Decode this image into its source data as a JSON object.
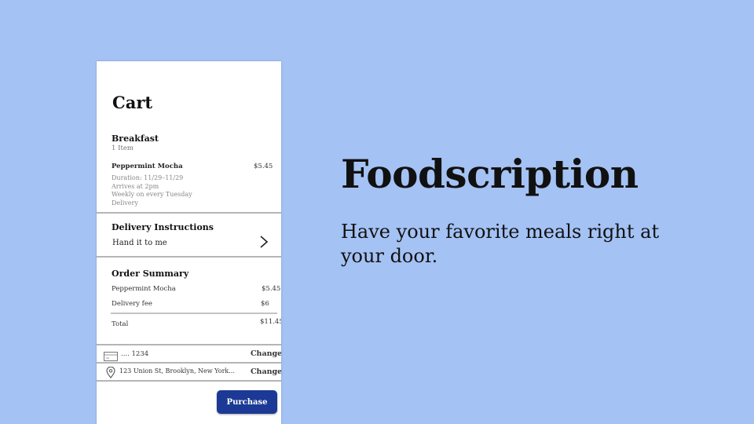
{
  "cart": {
    "title": "Cart",
    "section_title": "Breakfast",
    "item_count": "1 Item",
    "item": {
      "name": "Peppermint Mocha",
      "price": "$5.45",
      "details": [
        "Duration: 11/29–11/29",
        "Arrives at 2pm",
        "Weekly on every Tuesday",
        "Delivery"
      ]
    }
  },
  "delivery": {
    "title": "Delivery Instructions",
    "value": "Hand it to me",
    "chevron_icon": "chevron-right-icon"
  },
  "summary": {
    "title": "Order Summary",
    "rows": [
      {
        "label": "Peppermint Mocha",
        "value": "$5.45"
      },
      {
        "label": "Delivery fee",
        "value": "$6"
      }
    ],
    "total_label": "Total",
    "total_value": "$11.45"
  },
  "payment": {
    "icon": "credit-card-icon",
    "card": ".... 1234",
    "change_label": "Change"
  },
  "address": {
    "icon": "location-pin-icon",
    "text": "123 Union St, Brooklyn, New York...",
    "change_label": "Change"
  },
  "purchase_label": "Purchase",
  "brand": {
    "title": "Foodscription",
    "tagline": "Have your favorite meals right at your door."
  },
  "colors": {
    "background": "#a4c2f4",
    "button": "#1c3a95"
  }
}
